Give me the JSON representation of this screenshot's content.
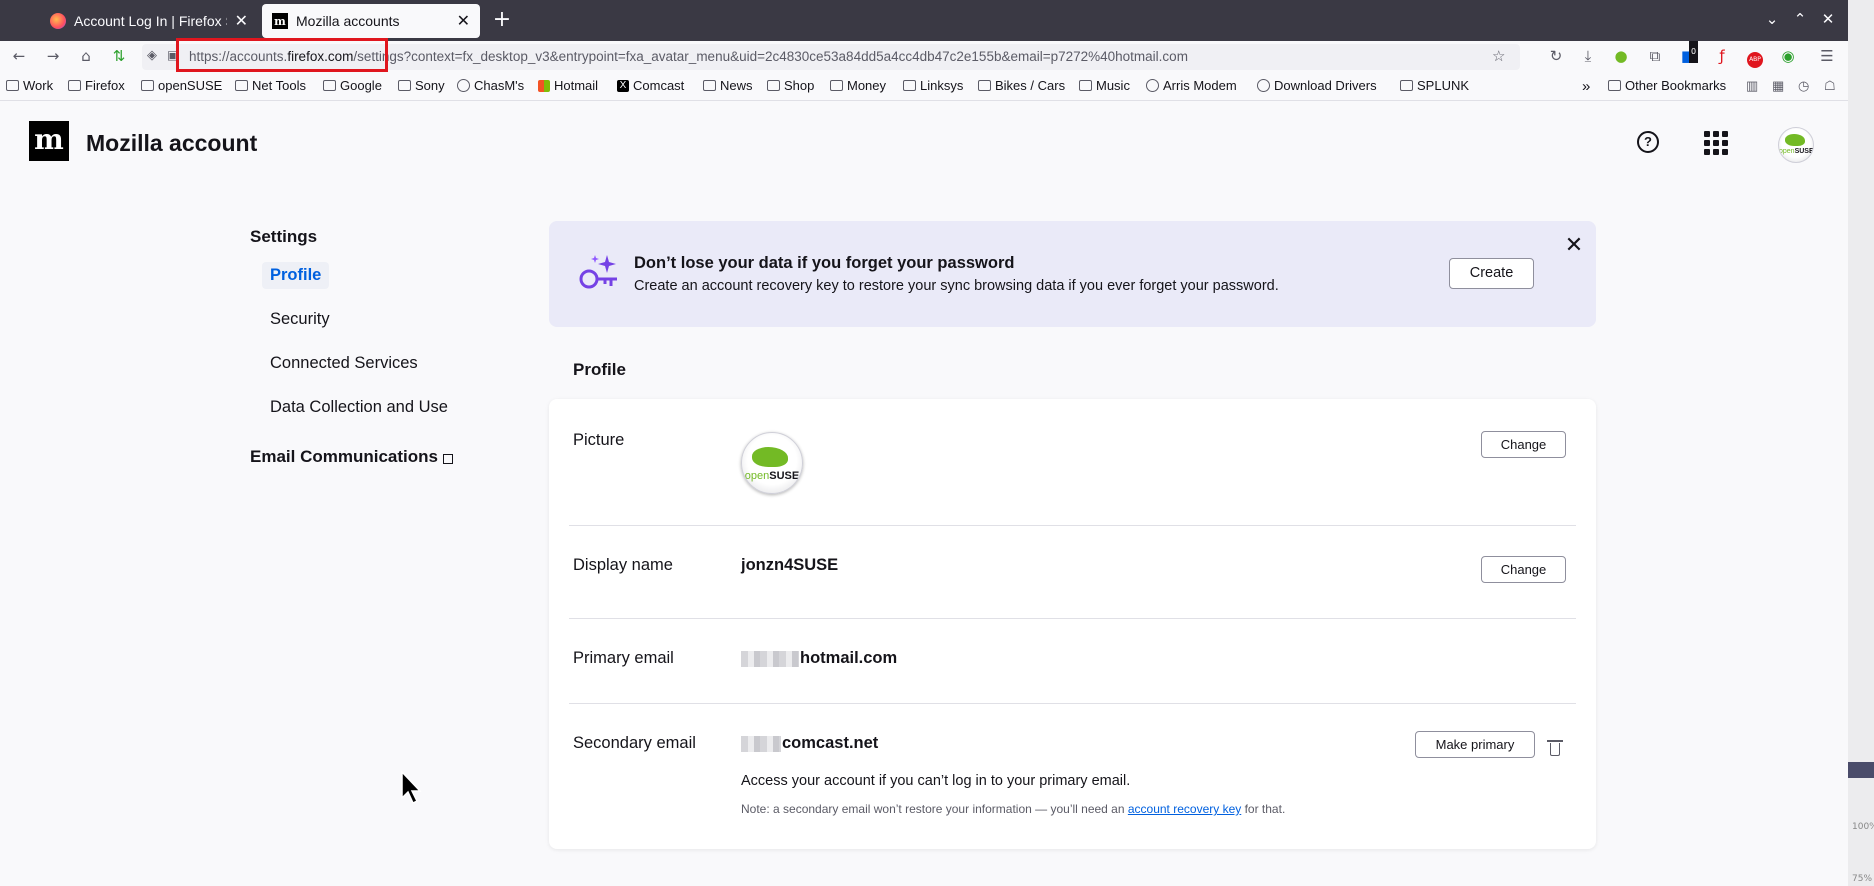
{
  "browser": {
    "tabs": [
      {
        "title": "Account Log In | Firefox S",
        "favicon": "firefox-icon",
        "active": false
      },
      {
        "title": "Mozilla accounts",
        "favicon": "mozilla-m-icon",
        "active": true
      }
    ],
    "url": {
      "prefix": "https://accounts.",
      "domain": "firefox.com",
      "path": "/settings?context=fx_desktop_v3&entrypoint=fxa_avatar_menu&uid=2c4830ce53a84dd5a4cc4db47c2e155b&email=p7272%40hotmail.com"
    },
    "downloads_badge": "0",
    "bookmarks": [
      {
        "label": "Work",
        "icon": "folder-icon"
      },
      {
        "label": "Firefox",
        "icon": "folder-icon"
      },
      {
        "label": "openSUSE",
        "icon": "folder-icon"
      },
      {
        "label": "Net Tools",
        "icon": "folder-icon"
      },
      {
        "label": "Google",
        "icon": "folder-icon"
      },
      {
        "label": "Sony",
        "icon": "folder-icon"
      },
      {
        "label": "ChasM's",
        "icon": "globe-icon"
      },
      {
        "label": "Hotmail",
        "icon": "microsoft-icon"
      },
      {
        "label": "Comcast",
        "icon": "x-icon"
      },
      {
        "label": "News",
        "icon": "folder-icon"
      },
      {
        "label": "Shop",
        "icon": "folder-icon"
      },
      {
        "label": "Money",
        "icon": "folder-icon"
      },
      {
        "label": "Linksys",
        "icon": "folder-icon"
      },
      {
        "label": "Bikes / Cars",
        "icon": "folder-icon"
      },
      {
        "label": "Music",
        "icon": "folder-icon"
      },
      {
        "label": "Arris Modem",
        "icon": "globe-icon"
      },
      {
        "label": "Download Drivers",
        "icon": "globe-icon"
      },
      {
        "label": "SPLUNK",
        "icon": "folder-icon"
      }
    ],
    "other_bookmarks": "Other Bookmarks",
    "right_edge": {
      "zoom1": "100%",
      "zoom2": "75%"
    }
  },
  "header": {
    "logo_letter": "m",
    "title": "Mozilla account",
    "avatar_text_prefix": "open",
    "avatar_text": "SUSE"
  },
  "sidebar": {
    "heading": "Settings",
    "items": [
      {
        "label": "Profile",
        "active": true
      },
      {
        "label": "Security",
        "active": false
      },
      {
        "label": "Connected Services",
        "active": false
      },
      {
        "label": "Data Collection and Use",
        "active": false
      }
    ],
    "email_communications": "Email Communications"
  },
  "banner": {
    "title": "Don’t lose your data if you forget your password",
    "text": "Create an account recovery key to restore your sync browsing data if you ever forget your password.",
    "create_label": "Create",
    "close_symbol": "✕"
  },
  "profile": {
    "heading": "Profile",
    "picture": {
      "label": "Picture",
      "button": "Change"
    },
    "display_name": {
      "label": "Display name",
      "value": "jonzn4SUSE",
      "button": "Change"
    },
    "primary_email": {
      "label": "Primary email",
      "value": "hotmail.com"
    },
    "secondary_email": {
      "label": "Secondary email",
      "value": "comcast.net",
      "button": "Make primary",
      "access_text": "Access your account if you can’t log in to your primary email.",
      "note_before": "Note: a secondary email won’t restore your information — you’ll need an ",
      "note_link": "account recovery key",
      "note_after": " for that."
    }
  },
  "colors": {
    "accent": "#0060df",
    "banner_bg": "#eaeaf8",
    "highlight": "#e0161e",
    "opensuse_green": "#73ba25"
  }
}
